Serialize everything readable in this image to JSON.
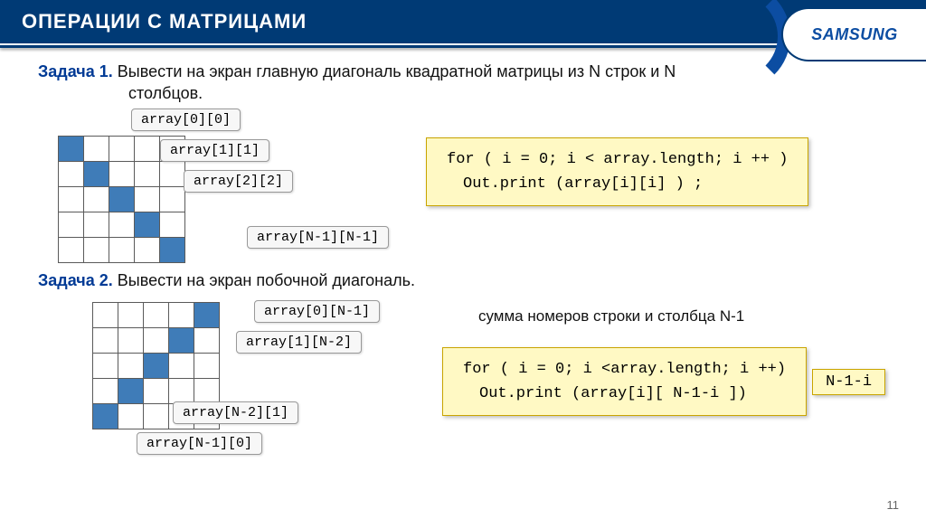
{
  "header": {
    "title": "ОПЕРАЦИИ С МАТРИЦАМИ",
    "logo": "SAMSUNG"
  },
  "task1": {
    "label": "Задача 1.",
    "text_line1": "Вывести на экран главную диагональ квадратной матрицы из N строк и N",
    "text_line2": "столбцов."
  },
  "labels1": {
    "l0": "array[0][0]",
    "l1": "array[1][1]",
    "l2": "array[2][2]",
    "lN": "array[N-1][N-1]"
  },
  "code1": {
    "line1": "for ( i = 0;  i < array.length;  i ++ )",
    "line2": "Out.print (array[i][i] ) ;"
  },
  "task2": {
    "label": "Задача 2.",
    "text": "Вывести на экран побочной диагональ."
  },
  "labels2": {
    "l0": "array[0][N-1]",
    "l1": "array[1][N-2]",
    "lN2": "array[N-2][1]",
    "lN1": "array[N-1][0]"
  },
  "hint2": "сумма номеров строки и столбца N-1",
  "code2": {
    "line1": "for ( i = 0;  i <array.length;  i ++)",
    "line2_a": "Out.print (array[i][ N-1-i ])",
    "answer": "N-1-i"
  },
  "pagenum": "11"
}
